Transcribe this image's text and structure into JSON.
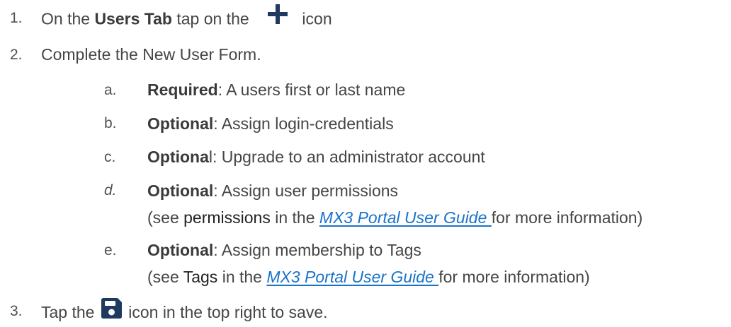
{
  "steps": [
    {
      "number": "1.",
      "before": "On the ",
      "bold": "Users Tab",
      "middle": " tap on the ",
      "icon": "plus-icon",
      "after": " icon"
    },
    {
      "number": "2.",
      "text": "Complete the New User Form.",
      "substeps": [
        {
          "letter": "a.",
          "bold": "Required",
          "text": ": A users first or last name"
        },
        {
          "letter": "b.",
          "bold": "Optional",
          "text": ": Assign login-credentials"
        },
        {
          "letter": "c.",
          "bold": "Optiona",
          "text": "l: Upgrade to an administrator account"
        },
        {
          "letter": "d.",
          "bold": "Optional",
          "text": ": Assign user permissions",
          "note_before": "(see ",
          "note_term": "permissions",
          "note_mid": " in the ",
          "note_link": "MX3 Portal User Guide ",
          "note_after": "for more information)"
        },
        {
          "letter": "e.",
          "bold": "Optional",
          "text": ": Assign membership to Tags",
          "note_before": "(see ",
          "note_term": "Tags",
          "note_mid": " in the ",
          "note_link": "MX3 Portal User Guide ",
          "note_after": "for more information)"
        }
      ]
    },
    {
      "number": "3.",
      "before": "Tap the ",
      "icon": "save-icon",
      "after": " icon in the top right to save."
    }
  ],
  "colors": {
    "text": "#454545",
    "link": "#1a73c8",
    "icon": "#1f3a5f"
  }
}
